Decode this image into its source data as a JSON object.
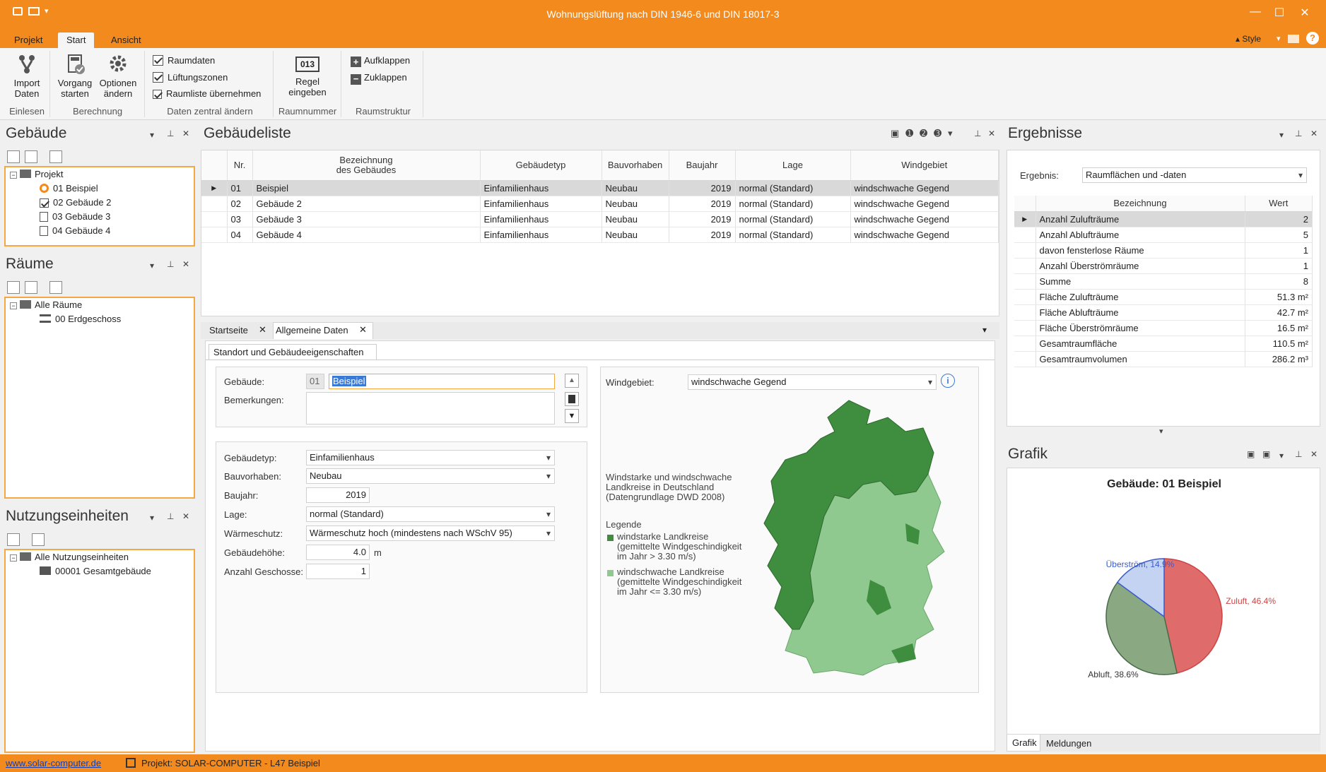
{
  "window": {
    "title": "Wohnungslüftung nach DIN 1946-6 und DIN 18017-3",
    "min": "—",
    "max": "☐",
    "close": "✕"
  },
  "menu": {
    "tabs": [
      "Projekt",
      "Start",
      "Ansicht"
    ],
    "style_label": "Style",
    "help": "?"
  },
  "ribbon": {
    "import": "Import\nDaten",
    "vorgang": "Vorgang\nstarten",
    "optionen": "Optionen\nändern",
    "raumdaten": "Raumdaten",
    "lueftungszonen": "Lüftungszonen",
    "raumliste": "Raumliste übernehmen",
    "regel_icon": "013",
    "regel": "Regel\neingeben",
    "aufklappen": "Aufklappen",
    "zuklappen": "Zuklappen",
    "groups": [
      "Einlesen",
      "Berechnung",
      "Daten zentral ändern",
      "Raumnummer",
      "Raumstruktur"
    ]
  },
  "gebaeude_panel": {
    "title": "Gebäude",
    "root": "Projekt",
    "items": [
      "01 Beispiel",
      "02 Gebäude 2",
      "03 Gebäude 3",
      "04 Gebäude 4"
    ]
  },
  "raeume_panel": {
    "title": "Räume",
    "root": "Alle Räume",
    "items": [
      "00 Erdgeschoss"
    ]
  },
  "nutzung_panel": {
    "title": "Nutzungseinheiten",
    "root": "Alle Nutzungseinheiten",
    "items": [
      "00001 Gesamtgebäude"
    ]
  },
  "gebaeudeliste": {
    "title": "Gebäudeliste",
    "columns": [
      "Nr.",
      "Bezeichnung des Gebäudes",
      "Gebäudetyp",
      "Bauvorhaben",
      "Baujahr",
      "Lage",
      "Windgebiet"
    ],
    "col1a": "Bezeichnung",
    "col1b": "des Gebäudes",
    "rows": [
      [
        "01",
        "Beispiel",
        "Einfamilienhaus",
        "Neubau",
        "2019",
        "normal (Standard)",
        "windschwache Gegend"
      ],
      [
        "02",
        "Gebäude 2",
        "Einfamilienhaus",
        "Neubau",
        "2019",
        "normal (Standard)",
        "windschwache Gegend"
      ],
      [
        "03",
        "Gebäude 3",
        "Einfamilienhaus",
        "Neubau",
        "2019",
        "normal (Standard)",
        "windschwache Gegend"
      ],
      [
        "04",
        "Gebäude 4",
        "Einfamilienhaus",
        "Neubau",
        "2019",
        "normal (Standard)",
        "windschwache Gegend"
      ]
    ]
  },
  "doc_tabs": [
    "Startseite",
    "Allgemeine Daten"
  ],
  "form": {
    "subtab": "Standort und Gebäudeeigenschaften",
    "gebaeude_label": "Gebäude:",
    "gebaeude_nr": "01",
    "gebaeude_value": "Beispiel",
    "bemerkungen_label": "Bemerkungen:",
    "gebaeudetyp_label": "Gebäudetyp:",
    "gebaeudetyp": "Einfamilienhaus",
    "bauvorhaben_label": "Bauvorhaben:",
    "bauvorhaben": "Neubau",
    "baujahr_label": "Baujahr:",
    "baujahr": "2019",
    "lage_label": "Lage:",
    "lage": "normal (Standard)",
    "waermeschutz_label": "Wärmeschutz:",
    "waermeschutz": "Wärmeschutz hoch (mindestens nach WSchV 95)",
    "hoehe_label": "Gebäudehöhe:",
    "hoehe": "4.0",
    "hoehe_unit": "m",
    "geschosse_label": "Anzahl Geschosse:",
    "geschosse": "1",
    "windgebiet_label": "Windgebiet:",
    "windgebiet": "windschwache Gegend",
    "map_caption": "Windstarke und windschwache\nLandkreise in Deutschland\n(Datengrundlage DWD 2008)",
    "legend_title": "Legende",
    "legend_strong": "windstarke Landkreise\n(gemittelte Windgeschindigkeit\nim Jahr > 3.30 m/s)",
    "legend_weak": "windschwache Landkreise\n(gemittelte Windgeschindigkeit\nim Jahr <= 3.30 m/s)",
    "color_strong": "#3f8d3f",
    "color_weak": "#8fc98f"
  },
  "ergebnisse": {
    "title": "Ergebnisse",
    "ergebnis_label": "Ergebnis:",
    "ergebnis_value": "Raumflächen und -daten",
    "columns": [
      "Bezeichnung",
      "Wert"
    ],
    "rows": [
      [
        "Anzahl Zulufträume",
        "2"
      ],
      [
        "Anzahl Ablufträume",
        "5"
      ],
      [
        "davon fensterlose Räume",
        "1"
      ],
      [
        "Anzahl Überströmräume",
        "1"
      ],
      [
        "Summe",
        "8"
      ],
      [
        "Fläche Zulufträume",
        "51.3 m²"
      ],
      [
        "Fläche Ablufträume",
        "42.7 m²"
      ],
      [
        "Fläche Überströmräume",
        "16.5 m²"
      ],
      [
        "Gesamtraumfläche",
        "110.5 m²"
      ],
      [
        "Gesamtraumvolumen",
        "286.2 m³"
      ]
    ]
  },
  "grafik": {
    "title": "Grafik",
    "tabs": [
      "Grafik",
      "Meldungen"
    ]
  },
  "chart_data": {
    "type": "pie",
    "title": "Gebäude: 01 Beispiel",
    "slices": [
      {
        "label": "Zuluft, 46.4%",
        "value": 46.4,
        "color": "#e06b6b"
      },
      {
        "label": "Abluft, 38.6%",
        "value": 38.6,
        "color": "#8aa882"
      },
      {
        "label": "Überström, 14.9%",
        "value": 14.9,
        "color": "#c4d3f1"
      }
    ]
  },
  "status": {
    "link": "www.solar-computer.de",
    "project": "Projekt: SOLAR-COMPUTER - L47 Beispiel"
  }
}
